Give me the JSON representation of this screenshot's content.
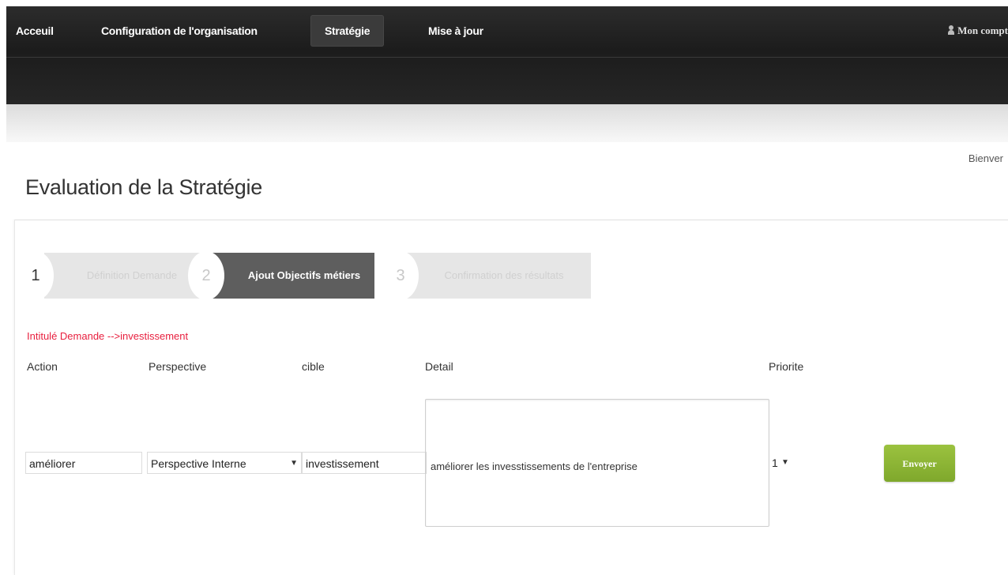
{
  "nav": {
    "items": [
      {
        "label": "Acceuil"
      },
      {
        "label": "Configuration de l'organisation"
      },
      {
        "label": "Stratégie"
      },
      {
        "label": "Mise à jour"
      }
    ],
    "active": "Stratégie",
    "account_label": "Mon compt",
    "account_icon": "user-icon"
  },
  "welcome_text": "Bienver",
  "page_title": "Evaluation de la Stratégie",
  "steps": [
    {
      "number": "1",
      "label": "Définition Demande",
      "state": "inactive"
    },
    {
      "number": "2",
      "label": "Ajout Objectifs métiers",
      "state": "active"
    },
    {
      "number": "3",
      "label": "Confirmation des résultats",
      "state": "inactive"
    }
  ],
  "form": {
    "heading": "Intitulé Demande -->investissement",
    "columns": {
      "action": "Action",
      "perspective": "Perspective",
      "cible": "cible",
      "detail": "Detail",
      "priorite": "Priorite"
    },
    "action_value": "améliorer",
    "perspective_value": "Perspective Interne",
    "cible_value": "investissement",
    "detail_value": "améliorer les invesstissements de l'entreprise",
    "priorite_value": "1",
    "submit_label": "Envoyer"
  },
  "colors": {
    "nav_bg": "#1c1c1c",
    "active_step": "#5e5e5e",
    "inactive_step": "#e6e6e6",
    "heading_red": "#e8203f",
    "button_green": "#8bb432"
  }
}
